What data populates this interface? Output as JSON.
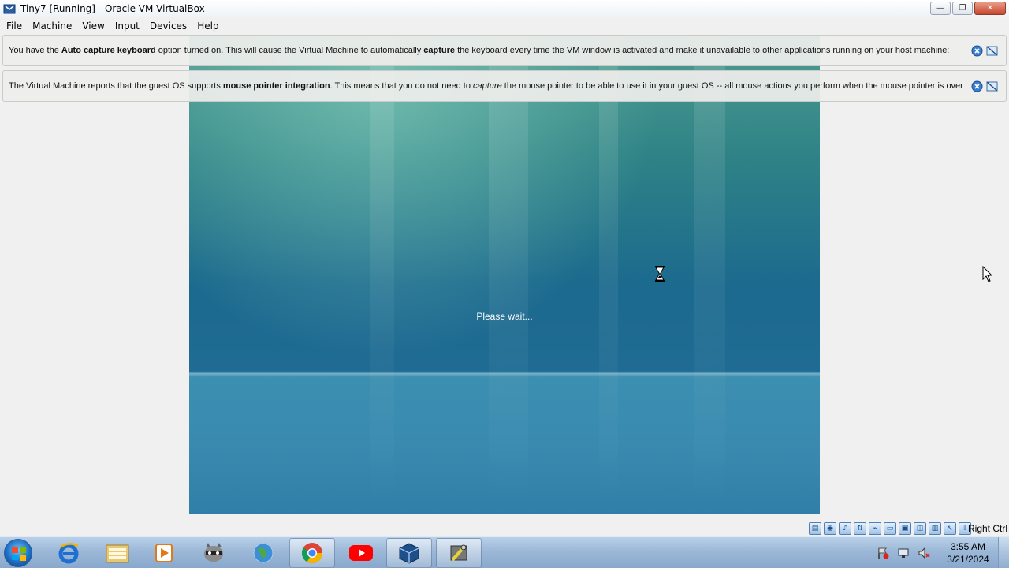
{
  "window": {
    "title": "Tiny7 [Running] - Oracle VM VirtualBox",
    "controls": {
      "minimize": "—",
      "maximize": "❐",
      "close": "✕"
    }
  },
  "menubar": {
    "items": [
      "File",
      "Machine",
      "View",
      "Input",
      "Devices",
      "Help"
    ]
  },
  "notifications": [
    {
      "pre": "You have the ",
      "b1": "Auto capture keyboard",
      "mid": " option turned on. This will cause the Virtual Machine to automatically ",
      "b2": "capture",
      "post": " the keyboard every time the VM window is activated and make it unavailable to other applications running on your host machine:"
    },
    {
      "pre": "The Virtual Machine reports that the guest OS supports ",
      "b1": "mouse pointer integration",
      "mid": ". This means that you do not need to ",
      "i1": "capture",
      "post": " the mouse pointer to be able to use it in your guest OS -- all mouse actions you perform when the mouse pointer is over"
    }
  ],
  "vm_screen": {
    "status_text": "Please wait..."
  },
  "statusbar": {
    "icons": [
      "hard-disk-icon",
      "optical-drive-icon",
      "audio-icon",
      "network-icon",
      "usb-icon",
      "shared-folders-icon",
      "display-icon",
      "video-capture-icon",
      "cpu-icon",
      "mouse-integration-icon",
      "host-key-icon"
    ],
    "host_key": "Right Ctrl"
  },
  "taskbar": {
    "apps": [
      "internet-explorer",
      "windows-explorer",
      "media-player",
      "raccoon-app",
      "globe-app",
      "chrome",
      "youtube",
      "virtualbox",
      "wrench-app"
    ],
    "clock_time": "3:55 AM",
    "clock_date": "3/21/2024"
  },
  "colors": {
    "taskbar": "#9cb8d8",
    "vm_top": "#4f9d91",
    "vm_mid": "#1c6a8e"
  }
}
